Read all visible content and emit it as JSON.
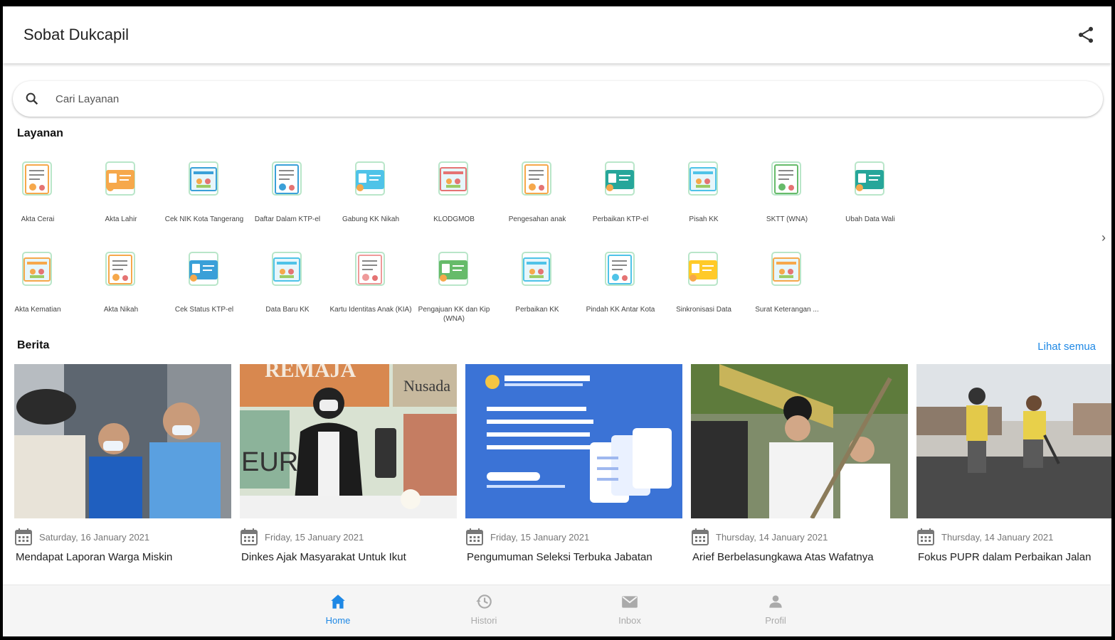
{
  "app": {
    "title": "Sobat Dukcapil"
  },
  "search": {
    "placeholder": "Cari Layanan"
  },
  "services_section": {
    "title": "Layanan"
  },
  "services": [
    {
      "label": "Akta Cerai",
      "icon": "document-couple-icon",
      "color": "#f6a84b"
    },
    {
      "label": "Akta Lahir",
      "icon": "document-baby-icon",
      "color": "#f6a84b"
    },
    {
      "label": "Cek NIK Kota Tangerang",
      "icon": "id-card-search-icon",
      "color": "#3aa0d8"
    },
    {
      "label": "Daftar Dalam KTP-el",
      "icon": "id-card-icon",
      "color": "#3aa0d8"
    },
    {
      "label": "Gabung KK Nikah",
      "icon": "family-card-icon",
      "color": "#4fc3e8"
    },
    {
      "label": "KLODGMOB",
      "icon": "document-list-icon",
      "color": "#e57373"
    },
    {
      "label": "Pengesahan anak",
      "icon": "document-child-icon",
      "color": "#f6a84b"
    },
    {
      "label": "Perbaikan KTP-el",
      "icon": "id-card-edit-icon",
      "color": "#26a69a"
    },
    {
      "label": "Pisah KK",
      "icon": "split-card-icon",
      "color": "#4fc3e8"
    },
    {
      "label": "SKTT (WNA)",
      "icon": "foreign-card-icon",
      "color": "#66bb6a"
    },
    {
      "label": "Ubah Data Wali",
      "icon": "guardian-card-icon",
      "color": "#26a69a"
    },
    {
      "label": "Akta Kematian",
      "icon": "document-tomb-icon",
      "color": "#f6a84b"
    },
    {
      "label": "Akta Nikah",
      "icon": "document-marriage-icon",
      "color": "#f6a84b"
    },
    {
      "label": "Cek Status KTP-el",
      "icon": "id-card-status-icon",
      "color": "#3aa0d8"
    },
    {
      "label": "Data Baru KK",
      "icon": "new-card-icon",
      "color": "#4fc3e8"
    },
    {
      "label": "Kartu Identitas Anak (KIA)",
      "icon": "child-id-card-icon",
      "color": "#ef9a9a"
    },
    {
      "label": "Pengajuan KK dan Kip (WNA)",
      "icon": "hand-card-icon",
      "color": "#66bb6a"
    },
    {
      "label": "Perbaikan KK",
      "icon": "card-repair-icon",
      "color": "#4fc3e8"
    },
    {
      "label": "Pindah KK Antar Kota",
      "icon": "card-move-icon",
      "color": "#4fc3e8"
    },
    {
      "label": "Sinkronisasi Data",
      "icon": "folder-sync-icon",
      "color": "#ffca28"
    },
    {
      "label": "Surat Keterangan ...",
      "icon": "document-location-icon",
      "color": "#f6a84b"
    }
  ],
  "news_section": {
    "title": "Berita",
    "see_all": "Lihat semua"
  },
  "news": [
    {
      "date": "Saturday, 16 January 2021",
      "headline": "Mendapat Laporan Warga Miskin",
      "image": "photo-officials-masks"
    },
    {
      "date": "Friday, 15 January 2021",
      "headline": "Dinkes Ajak Masyarakat Untuk Ikut",
      "image": "photo-woman-speaking"
    },
    {
      "date": "Friday, 15 January 2021",
      "headline": "Pengumuman Seleksi Terbuka Jabatan",
      "image": "announcement-banner"
    },
    {
      "date": "Thursday, 14 January 2021",
      "headline": "Arief Berbelasungkawa Atas Wafatnya",
      "image": "photo-funeral"
    },
    {
      "date": "Thursday, 14 January 2021",
      "headline": "Fokus PUPR dalam Perbaikan Jalan",
      "image": "photo-road-workers"
    }
  ],
  "bottom_nav": [
    {
      "label": "Home",
      "icon": "home-icon",
      "active": true
    },
    {
      "label": "Histori",
      "icon": "history-icon",
      "active": false
    },
    {
      "label": "Inbox",
      "icon": "mail-icon",
      "active": false
    },
    {
      "label": "Profil",
      "icon": "person-icon",
      "active": false
    }
  ],
  "colors": {
    "accent": "#1e88e5",
    "inactive": "#aaaaaa"
  }
}
